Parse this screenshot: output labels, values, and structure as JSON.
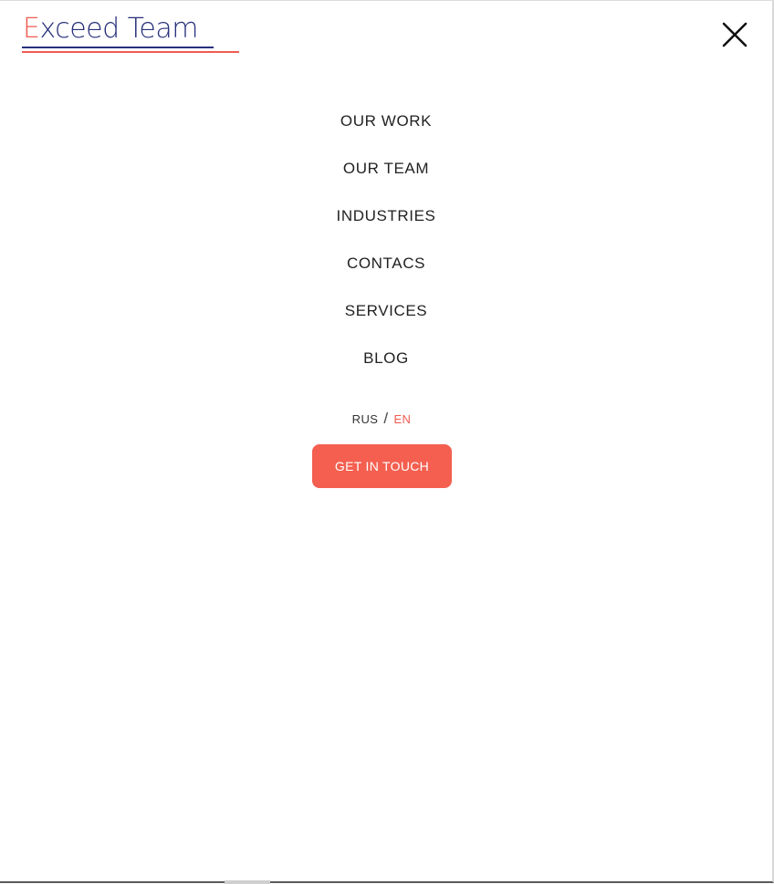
{
  "logo": {
    "initial": "E",
    "rest": "xceed Team"
  },
  "close_icon": "close-icon",
  "nav": {
    "items": [
      {
        "label": "OUR WORK"
      },
      {
        "label": "OUR TEAM"
      },
      {
        "label": "INDUSTRIES"
      },
      {
        "label": "CONTACS"
      },
      {
        "label": "SERVICES"
      },
      {
        "label": "BLOG"
      }
    ]
  },
  "language": {
    "rus": "RUS",
    "separator": "/",
    "en": "EN"
  },
  "cta": {
    "label": "GET IN TOUCH"
  },
  "colors": {
    "brand_red": "#f05b4f",
    "brand_navy": "#26307a",
    "button_bg": "#f45f50"
  }
}
